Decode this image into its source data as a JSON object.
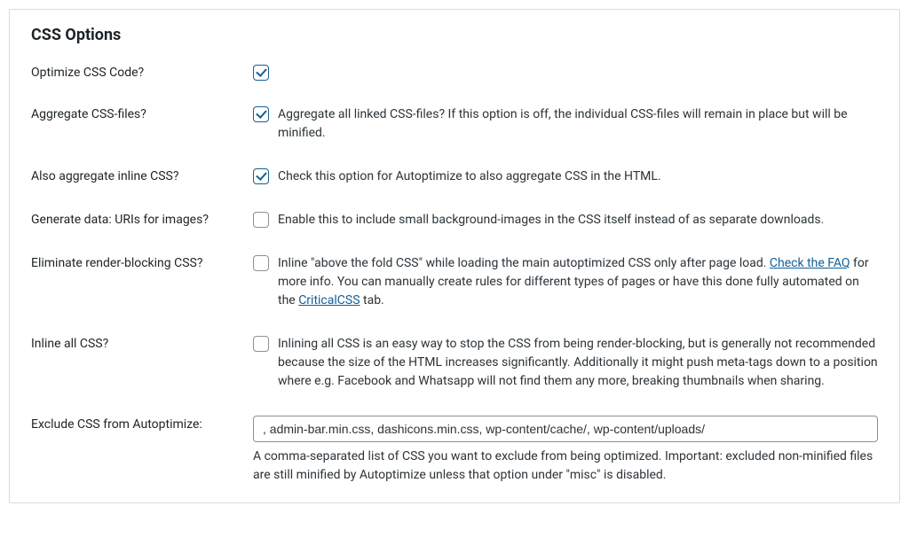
{
  "section": {
    "title": "CSS Options"
  },
  "optimize": {
    "label": "Optimize CSS Code?"
  },
  "aggregate": {
    "label": "Aggregate CSS-files?",
    "desc": "Aggregate all linked CSS-files? If this option is off, the individual CSS-files will remain in place but will be minified."
  },
  "inlineAgg": {
    "label": "Also aggregate inline CSS?",
    "desc": "Check this option for Autoptimize to also aggregate CSS in the HTML."
  },
  "dataUri": {
    "label": "Generate data: URIs for images?",
    "desc": "Enable this to include small background-images in the CSS itself instead of as separate downloads."
  },
  "renderBlock": {
    "label": "Eliminate render-blocking CSS?",
    "desc_pre": "Inline \"above the fold CSS\" while loading the main autoptimized CSS only after page load. ",
    "faq_link": "Check the FAQ",
    "desc_mid": " for more info. You can manually create rules for different types of pages or have this done fully automated on the ",
    "critical_link": "CriticalCSS",
    "desc_post": " tab."
  },
  "inlineAll": {
    "label": "Inline all CSS?",
    "desc": "Inlining all CSS is an easy way to stop the CSS from being render-blocking, but is generally not recommended because the size of the HTML increases significantly. Additionally it might push meta-tags down to a position where e.g. Facebook and Whatsapp will not find them any more, breaking thumbnails when sharing."
  },
  "exclude": {
    "label": "Exclude CSS from Autoptimize:",
    "value": ", admin-bar.min.css, dashicons.min.css, wp-content/cache/, wp-content/uploads/",
    "help": "A comma-separated list of CSS you want to exclude from being optimized. Important: excluded non-minified files are still minified by Autoptimize unless that option under \"misc\" is disabled."
  }
}
